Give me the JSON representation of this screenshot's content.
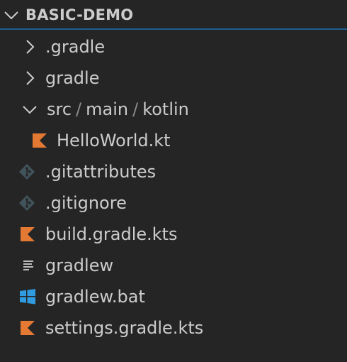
{
  "explorer": {
    "title": "BASIC-DEMO",
    "items": [
      {
        "label": ".gradle",
        "type": "folder",
        "icon": "chevron-right-icon"
      },
      {
        "label": "gradle",
        "type": "folder",
        "icon": "chevron-right-icon"
      },
      {
        "path": [
          "src",
          "main",
          "kotlin"
        ],
        "type": "folder",
        "icon": "chevron-down-icon"
      },
      {
        "label": "HelloWorld.kt",
        "type": "file",
        "icon": "kotlin-icon"
      },
      {
        "label": ".gitattributes",
        "type": "file",
        "icon": "git-icon"
      },
      {
        "label": ".gitignore",
        "type": "file",
        "icon": "git-icon"
      },
      {
        "label": "build.gradle.kts",
        "type": "file",
        "icon": "kotlin-icon"
      },
      {
        "label": "gradlew",
        "type": "file",
        "icon": "text-lines-icon"
      },
      {
        "label": "gradlew.bat",
        "type": "file",
        "icon": "windows-icon"
      },
      {
        "label": "settings.gradle.kts",
        "type": "file",
        "icon": "kotlin-icon"
      }
    ],
    "path_separator": "/"
  },
  "colors": {
    "background": "#252526",
    "text": "#cccccc",
    "kotlin_orange": "#e37933",
    "git_gray": "#41535b",
    "windows_blue": "#2f9cdf",
    "header_border": "#1f5f8f"
  }
}
